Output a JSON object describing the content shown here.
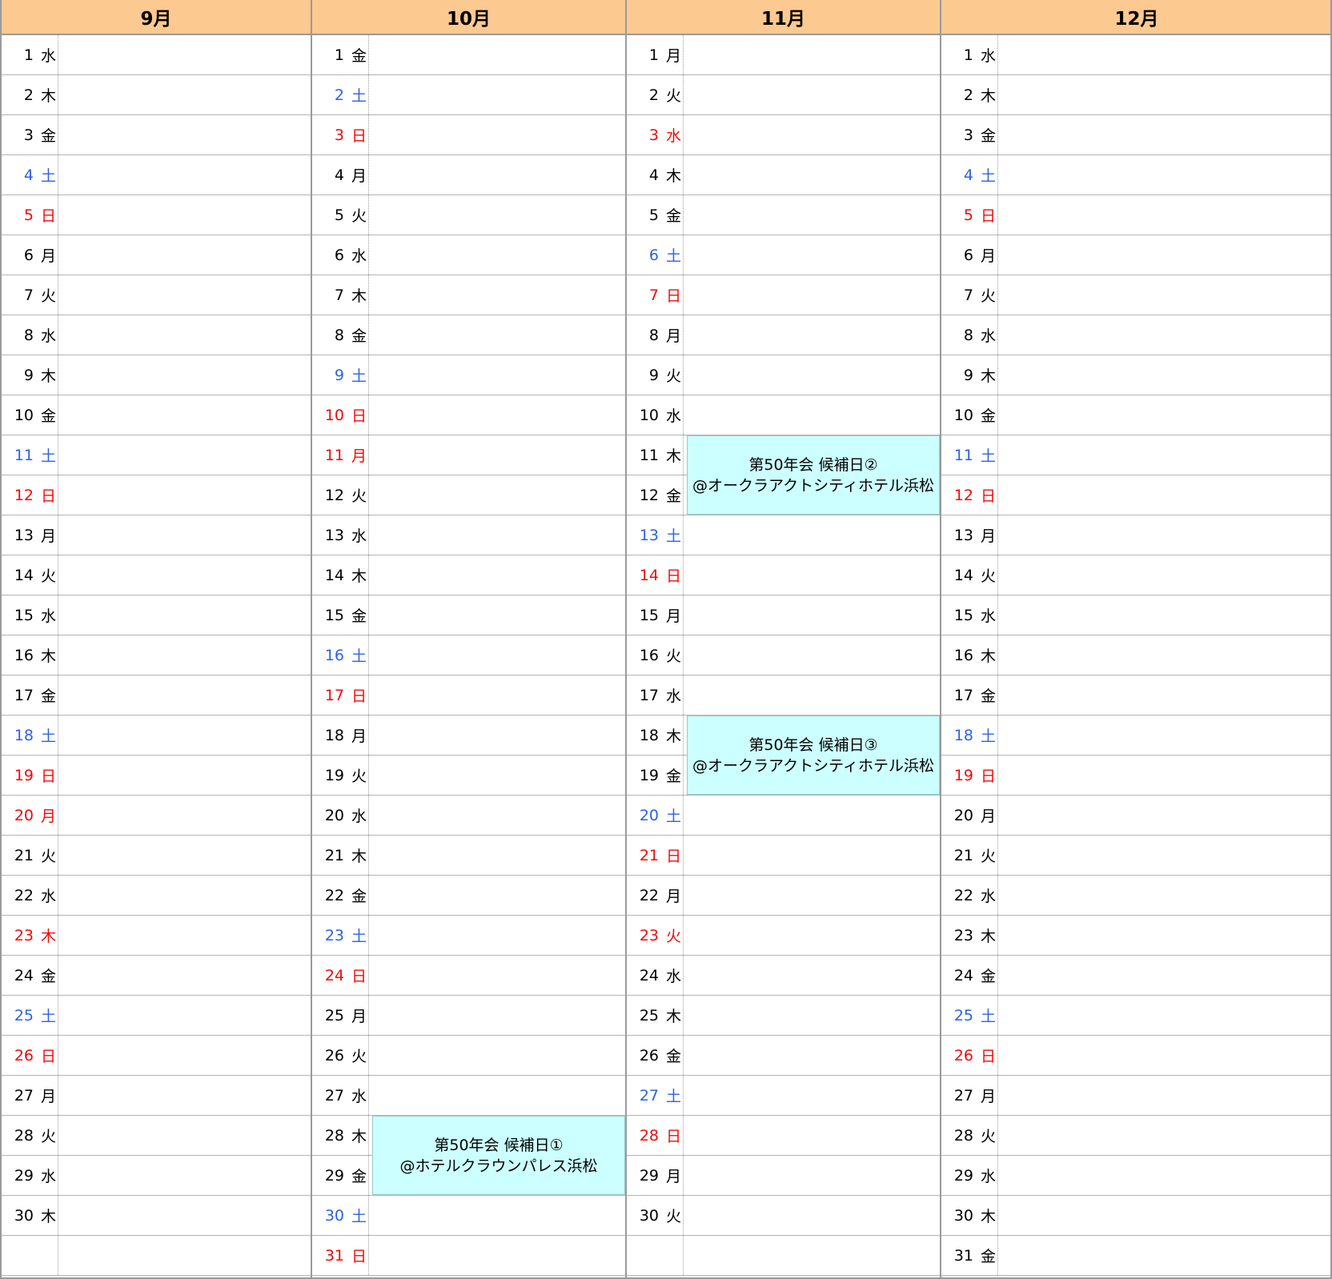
{
  "months": [
    {
      "label": "9月",
      "days": [
        {
          "d": "1",
          "w": "水",
          "t": "n"
        },
        {
          "d": "2",
          "w": "木",
          "t": "n"
        },
        {
          "d": "3",
          "w": "金",
          "t": "n"
        },
        {
          "d": "4",
          "w": "土",
          "t": "s"
        },
        {
          "d": "5",
          "w": "日",
          "t": "h"
        },
        {
          "d": "6",
          "w": "月",
          "t": "n"
        },
        {
          "d": "7",
          "w": "火",
          "t": "n"
        },
        {
          "d": "8",
          "w": "水",
          "t": "n"
        },
        {
          "d": "9",
          "w": "木",
          "t": "n"
        },
        {
          "d": "10",
          "w": "金",
          "t": "n"
        },
        {
          "d": "11",
          "w": "土",
          "t": "s"
        },
        {
          "d": "12",
          "w": "日",
          "t": "h"
        },
        {
          "d": "13",
          "w": "月",
          "t": "n"
        },
        {
          "d": "14",
          "w": "火",
          "t": "n"
        },
        {
          "d": "15",
          "w": "水",
          "t": "n"
        },
        {
          "d": "16",
          "w": "木",
          "t": "n"
        },
        {
          "d": "17",
          "w": "金",
          "t": "n"
        },
        {
          "d": "18",
          "w": "土",
          "t": "s"
        },
        {
          "d": "19",
          "w": "日",
          "t": "h"
        },
        {
          "d": "20",
          "w": "月",
          "t": "h"
        },
        {
          "d": "21",
          "w": "火",
          "t": "n"
        },
        {
          "d": "22",
          "w": "水",
          "t": "n"
        },
        {
          "d": "23",
          "w": "木",
          "t": "h"
        },
        {
          "d": "24",
          "w": "金",
          "t": "n"
        },
        {
          "d": "25",
          "w": "土",
          "t": "s"
        },
        {
          "d": "26",
          "w": "日",
          "t": "h"
        },
        {
          "d": "27",
          "w": "月",
          "t": "n"
        },
        {
          "d": "28",
          "w": "火",
          "t": "n"
        },
        {
          "d": "29",
          "w": "水",
          "t": "n"
        },
        {
          "d": "30",
          "w": "木",
          "t": "n"
        },
        {
          "d": "",
          "w": "",
          "t": "n"
        }
      ],
      "events": []
    },
    {
      "label": "10月",
      "days": [
        {
          "d": "1",
          "w": "金",
          "t": "n"
        },
        {
          "d": "2",
          "w": "土",
          "t": "s"
        },
        {
          "d": "3",
          "w": "日",
          "t": "h"
        },
        {
          "d": "4",
          "w": "月",
          "t": "n"
        },
        {
          "d": "5",
          "w": "火",
          "t": "n"
        },
        {
          "d": "6",
          "w": "水",
          "t": "n"
        },
        {
          "d": "7",
          "w": "木",
          "t": "n"
        },
        {
          "d": "8",
          "w": "金",
          "t": "n"
        },
        {
          "d": "9",
          "w": "土",
          "t": "s"
        },
        {
          "d": "10",
          "w": "日",
          "t": "h"
        },
        {
          "d": "11",
          "w": "月",
          "t": "h"
        },
        {
          "d": "12",
          "w": "火",
          "t": "n"
        },
        {
          "d": "13",
          "w": "水",
          "t": "n"
        },
        {
          "d": "14",
          "w": "木",
          "t": "n"
        },
        {
          "d": "15",
          "w": "金",
          "t": "n"
        },
        {
          "d": "16",
          "w": "土",
          "t": "s"
        },
        {
          "d": "17",
          "w": "日",
          "t": "h"
        },
        {
          "d": "18",
          "w": "月",
          "t": "n"
        },
        {
          "d": "19",
          "w": "火",
          "t": "n"
        },
        {
          "d": "20",
          "w": "水",
          "t": "n"
        },
        {
          "d": "21",
          "w": "木",
          "t": "n"
        },
        {
          "d": "22",
          "w": "金",
          "t": "n"
        },
        {
          "d": "23",
          "w": "土",
          "t": "s"
        },
        {
          "d": "24",
          "w": "日",
          "t": "h"
        },
        {
          "d": "25",
          "w": "月",
          "t": "n"
        },
        {
          "d": "26",
          "w": "火",
          "t": "n"
        },
        {
          "d": "27",
          "w": "水",
          "t": "n"
        },
        {
          "d": "28",
          "w": "木",
          "t": "n"
        },
        {
          "d": "29",
          "w": "金",
          "t": "n"
        },
        {
          "d": "30",
          "w": "土",
          "t": "s"
        },
        {
          "d": "31",
          "w": "日",
          "t": "h"
        }
      ],
      "events": [
        {
          "first_day": 28,
          "span_days": 2,
          "line1": "第50年会 候補日①",
          "line2": "@ホテルクラウンパレス浜松"
        }
      ]
    },
    {
      "label": "11月",
      "days": [
        {
          "d": "1",
          "w": "月",
          "t": "n"
        },
        {
          "d": "2",
          "w": "火",
          "t": "n"
        },
        {
          "d": "3",
          "w": "水",
          "t": "h"
        },
        {
          "d": "4",
          "w": "木",
          "t": "n"
        },
        {
          "d": "5",
          "w": "金",
          "t": "n"
        },
        {
          "d": "6",
          "w": "土",
          "t": "s"
        },
        {
          "d": "7",
          "w": "日",
          "t": "h"
        },
        {
          "d": "8",
          "w": "月",
          "t": "n"
        },
        {
          "d": "9",
          "w": "火",
          "t": "n"
        },
        {
          "d": "10",
          "w": "水",
          "t": "n"
        },
        {
          "d": "11",
          "w": "木",
          "t": "n"
        },
        {
          "d": "12",
          "w": "金",
          "t": "n"
        },
        {
          "d": "13",
          "w": "土",
          "t": "s"
        },
        {
          "d": "14",
          "w": "日",
          "t": "h"
        },
        {
          "d": "15",
          "w": "月",
          "t": "n"
        },
        {
          "d": "16",
          "w": "火",
          "t": "n"
        },
        {
          "d": "17",
          "w": "水",
          "t": "n"
        },
        {
          "d": "18",
          "w": "木",
          "t": "n"
        },
        {
          "d": "19",
          "w": "金",
          "t": "n"
        },
        {
          "d": "20",
          "w": "土",
          "t": "s"
        },
        {
          "d": "21",
          "w": "日",
          "t": "h"
        },
        {
          "d": "22",
          "w": "月",
          "t": "n"
        },
        {
          "d": "23",
          "w": "火",
          "t": "h"
        },
        {
          "d": "24",
          "w": "水",
          "t": "n"
        },
        {
          "d": "25",
          "w": "木",
          "t": "n"
        },
        {
          "d": "26",
          "w": "金",
          "t": "n"
        },
        {
          "d": "27",
          "w": "土",
          "t": "s"
        },
        {
          "d": "28",
          "w": "日",
          "t": "h"
        },
        {
          "d": "29",
          "w": "月",
          "t": "n"
        },
        {
          "d": "30",
          "w": "火",
          "t": "n"
        },
        {
          "d": "",
          "w": "",
          "t": "n"
        }
      ],
      "events": [
        {
          "first_day": 11,
          "span_days": 2,
          "line1": "第50年会 候補日②",
          "line2": "@オークラアクトシティホテル浜松"
        },
        {
          "first_day": 18,
          "span_days": 2,
          "line1": "第50年会 候補日③",
          "line2": "@オークラアクトシティホテル浜松"
        }
      ]
    },
    {
      "label": "12月",
      "days": [
        {
          "d": "1",
          "w": "水",
          "t": "n"
        },
        {
          "d": "2",
          "w": "木",
          "t": "n"
        },
        {
          "d": "3",
          "w": "金",
          "t": "n"
        },
        {
          "d": "4",
          "w": "土",
          "t": "s"
        },
        {
          "d": "5",
          "w": "日",
          "t": "h"
        },
        {
          "d": "6",
          "w": "月",
          "t": "n"
        },
        {
          "d": "7",
          "w": "火",
          "t": "n"
        },
        {
          "d": "8",
          "w": "水",
          "t": "n"
        },
        {
          "d": "9",
          "w": "木",
          "t": "n"
        },
        {
          "d": "10",
          "w": "金",
          "t": "n"
        },
        {
          "d": "11",
          "w": "土",
          "t": "s"
        },
        {
          "d": "12",
          "w": "日",
          "t": "h"
        },
        {
          "d": "13",
          "w": "月",
          "t": "n"
        },
        {
          "d": "14",
          "w": "火",
          "t": "n"
        },
        {
          "d": "15",
          "w": "水",
          "t": "n"
        },
        {
          "d": "16",
          "w": "木",
          "t": "n"
        },
        {
          "d": "17",
          "w": "金",
          "t": "n"
        },
        {
          "d": "18",
          "w": "土",
          "t": "s"
        },
        {
          "d": "19",
          "w": "日",
          "t": "h"
        },
        {
          "d": "20",
          "w": "月",
          "t": "n"
        },
        {
          "d": "21",
          "w": "火",
          "t": "n"
        },
        {
          "d": "22",
          "w": "水",
          "t": "n"
        },
        {
          "d": "23",
          "w": "木",
          "t": "n"
        },
        {
          "d": "24",
          "w": "金",
          "t": "n"
        },
        {
          "d": "25",
          "w": "土",
          "t": "s"
        },
        {
          "d": "26",
          "w": "日",
          "t": "h"
        },
        {
          "d": "27",
          "w": "月",
          "t": "n"
        },
        {
          "d": "28",
          "w": "火",
          "t": "n"
        },
        {
          "d": "29",
          "w": "水",
          "t": "n"
        },
        {
          "d": "30",
          "w": "木",
          "t": "n"
        },
        {
          "d": "31",
          "w": "金",
          "t": "n"
        }
      ],
      "events": []
    }
  ],
  "colors": {
    "header_bg": "#fcc990",
    "event_bg": "#ccffff",
    "saturday": "#2d62e6",
    "holiday": "#ee0b0b",
    "grid": "#9a9a9a"
  }
}
